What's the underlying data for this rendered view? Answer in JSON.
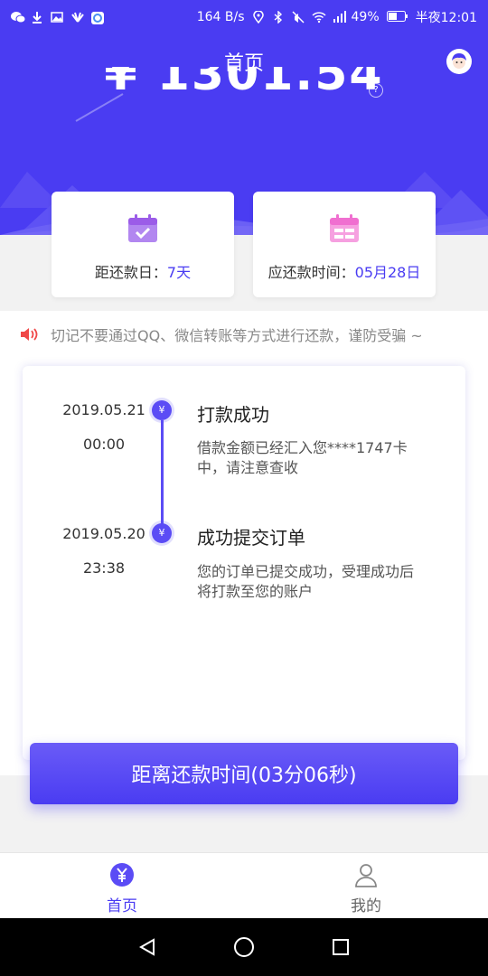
{
  "status_bar": {
    "network_speed": "164 B/s",
    "battery": "49%",
    "time": "半夜12:01",
    "left_icons": [
      "wechat-icon",
      "download-icon",
      "gallery-icon",
      "huawei-icon",
      "app-icon"
    ]
  },
  "header": {
    "title": "首页",
    "amount": "¥ 1301.54"
  },
  "cards": [
    {
      "label": "距还款日：",
      "value": "7天"
    },
    {
      "label": "应还款时间：",
      "value": "05月28日"
    }
  ],
  "notice": {
    "text": "切记不要通过QQ、微信转账等方式进行还款，谨防受骗 ~"
  },
  "timeline": [
    {
      "date": "2019.05.21",
      "time": "00:00",
      "title": "打款成功",
      "desc": "借款金额已经汇入您****1747卡中，请注意查收"
    },
    {
      "date": "2019.05.20",
      "time": "23:38",
      "title": "成功提交订单",
      "desc": "您的订单已提交成功，受理成功后将打款至您的账户"
    }
  ],
  "countdown": {
    "label": "距离还款时间(03分06秒)"
  },
  "tabs": [
    {
      "label": "首页",
      "active": true
    },
    {
      "label": "我的",
      "active": false
    }
  ],
  "colors": {
    "brand": "#4a3cf2",
    "accent_purple": "#9b5ce8",
    "accent_pink": "#f06fd0",
    "notice_red": "#f04848"
  }
}
